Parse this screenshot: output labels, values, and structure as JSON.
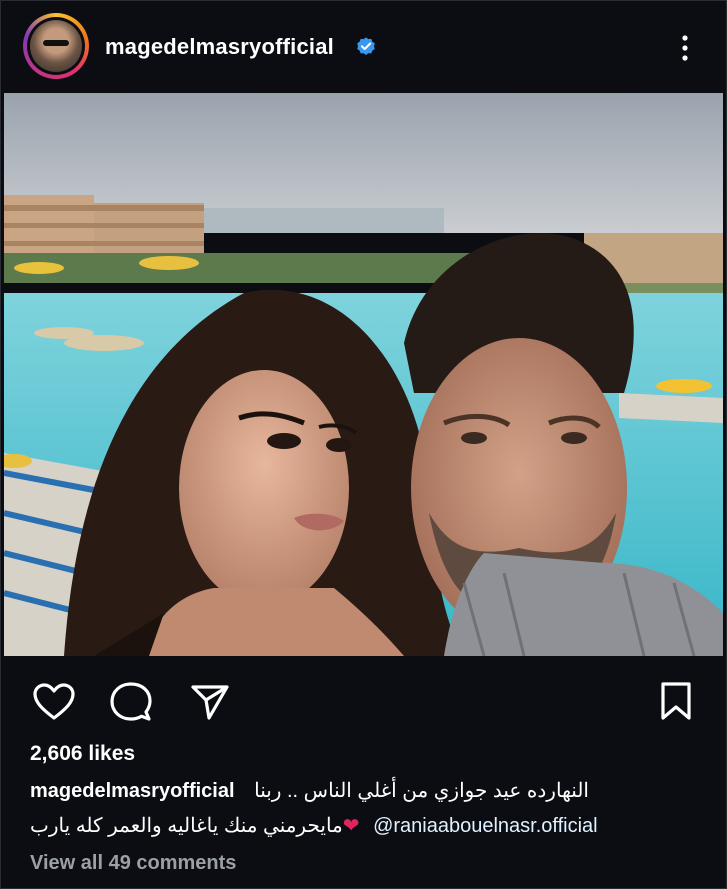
{
  "post": {
    "username": "magedelmasryofficial",
    "verified": true,
    "likes": "2,606 likes",
    "caption": {
      "user": "magedelmasryofficial",
      "line1_text": "النهارده عيد جوازي من أغلي الناس .. ربنا",
      "line2_text": "مايحرمني منك ياغاليه والعمر كله يارب",
      "heart": "❤",
      "mention": "@raniaabouelnasr.official"
    },
    "view_comments": "View all 49 comments"
  },
  "icons": [
    "avatar",
    "verified-badge-icon",
    "more-options-icon",
    "like-heart-icon",
    "comment-icon",
    "share-icon",
    "save-bookmark-icon"
  ],
  "colors": {
    "background": "#0b0d12",
    "verified": "#3897f0",
    "heart": "#e0245e",
    "muted_text": "#9aa0a6"
  }
}
